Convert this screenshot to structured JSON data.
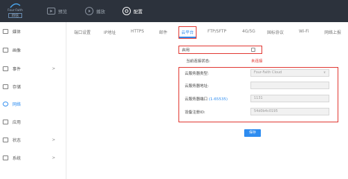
{
  "brand": {
    "name": "Four-Faith",
    "cn": "四信"
  },
  "topnav": [
    {
      "label": "预览",
      "icon": "preview-icon"
    },
    {
      "label": "播放",
      "icon": "play-icon"
    },
    {
      "label": "配置",
      "icon": "settings-icon",
      "active": true
    }
  ],
  "sidebar": {
    "items": [
      {
        "label": "媒体",
        "icon": "media-icon",
        "chevron": ""
      },
      {
        "label": "画像",
        "icon": "image-icon",
        "chevron": ""
      },
      {
        "label": "事件",
        "icon": "event-icon",
        "chevron": ">"
      },
      {
        "label": "存储",
        "icon": "storage-icon",
        "chevron": ""
      },
      {
        "label": "网络",
        "icon": "network-icon",
        "chevron": "",
        "active": true
      },
      {
        "label": "应用",
        "icon": "app-icon",
        "chevron": ""
      },
      {
        "label": "状态",
        "icon": "status-icon",
        "chevron": ">"
      },
      {
        "label": "系统",
        "icon": "system-icon",
        "chevron": ">"
      }
    ]
  },
  "tabs": [
    {
      "label": "端口设置"
    },
    {
      "label": "IP地址"
    },
    {
      "label": "HTTPS"
    },
    {
      "label": "邮件"
    },
    {
      "label": "云平台",
      "active": true
    },
    {
      "label": "FTP/SFTP"
    },
    {
      "label": "4G/5G"
    },
    {
      "label": "国标协议"
    },
    {
      "label": "Wi-Fi"
    },
    {
      "label": "网络上报"
    }
  ],
  "form": {
    "enable_label": "启用",
    "status_label": "当前连接状态:",
    "status_value": "未连接",
    "status_color": "#e0302a",
    "server_type_label": "云服务器类型:",
    "server_type_value": "Four-Faith Cloud",
    "server_addr_label": "云服务器地址:",
    "server_addr_value": "",
    "server_port_label": "云服务器端口",
    "server_port_range": "(1-65535)",
    "server_port_value": "1131",
    "device_id_label": "设备注册ID:",
    "device_id_value": "54d0b4c0195",
    "save_label": "保存"
  },
  "colors": {
    "accent": "#2d8cf0",
    "highlight": "#e0302a",
    "topbar": "#2c323c"
  }
}
